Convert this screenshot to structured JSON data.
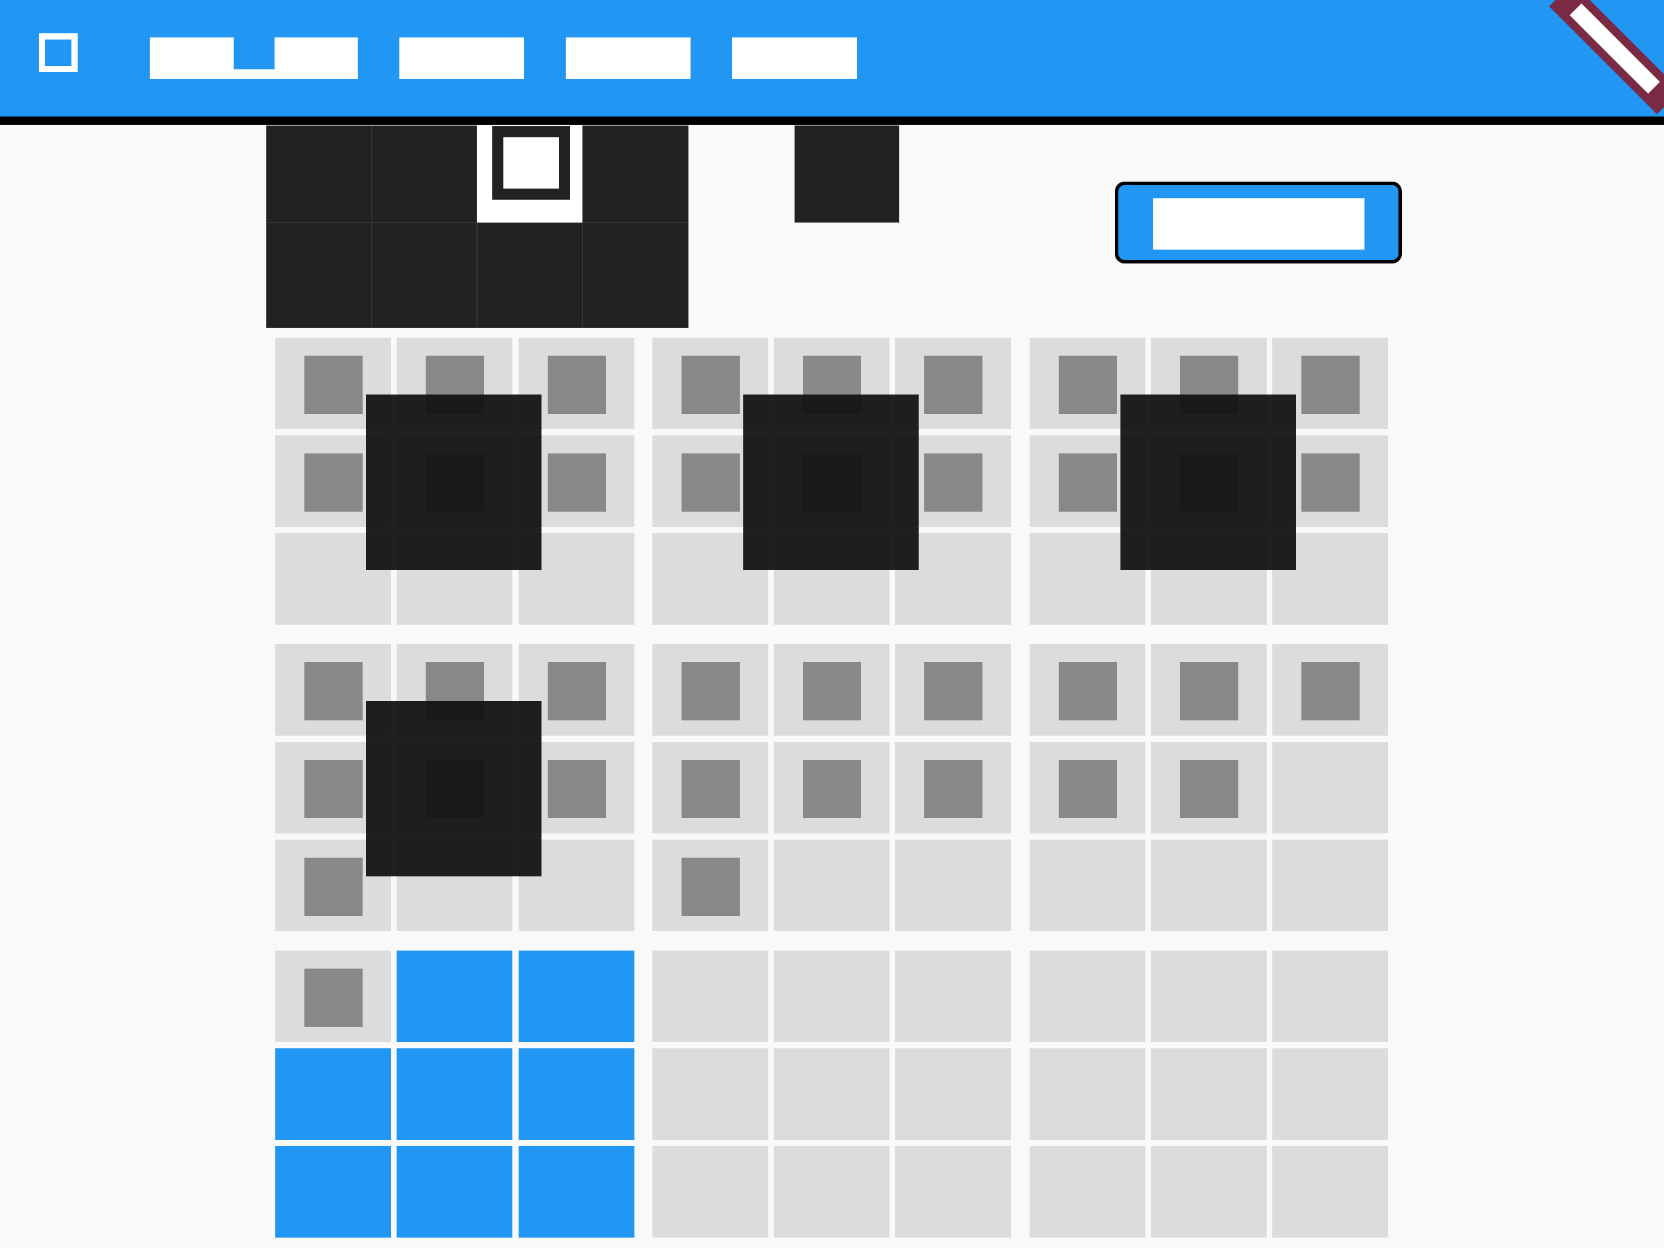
{
  "appbar": {
    "menu_icon": "menu-square-icon",
    "tabs": [
      {
        "label": ""
      },
      {
        "label": ""
      },
      {
        "label": ""
      },
      {
        "label": ""
      }
    ],
    "corner_icon": "ribbon-badge-icon",
    "colors": {
      "bar": "#2196f3",
      "ribbon": "#7b2a44"
    }
  },
  "action_button": {
    "label": ""
  },
  "board": {
    "rows": 9,
    "cols": 9,
    "filled_cells": [
      [
        0,
        0
      ],
      [
        0,
        1
      ],
      [
        0,
        2
      ],
      [
        0,
        3
      ],
      [
        0,
        4
      ],
      [
        0,
        5
      ],
      [
        0,
        6
      ],
      [
        0,
        7
      ],
      [
        0,
        8
      ],
      [
        1,
        0
      ],
      [
        1,
        1
      ],
      [
        1,
        2
      ],
      [
        1,
        3
      ],
      [
        1,
        4
      ],
      [
        1,
        5
      ],
      [
        1,
        6
      ],
      [
        1,
        7
      ],
      [
        1,
        8
      ],
      [
        3,
        0
      ],
      [
        3,
        1
      ],
      [
        3,
        2
      ],
      [
        3,
        3
      ],
      [
        3,
        4
      ],
      [
        3,
        5
      ],
      [
        3,
        6
      ],
      [
        3,
        7
      ],
      [
        3,
        8
      ],
      [
        4,
        0
      ],
      [
        4,
        1
      ],
      [
        4,
        2
      ],
      [
        4,
        3
      ],
      [
        4,
        4
      ],
      [
        4,
        5
      ],
      [
        4,
        6
      ],
      [
        4,
        7
      ],
      [
        5,
        0
      ],
      [
        5,
        3
      ],
      [
        6,
        0
      ]
    ],
    "highlight_cells": [
      [
        6,
        1
      ],
      [
        6,
        2
      ],
      [
        7,
        0
      ],
      [
        7,
        1
      ],
      [
        7,
        2
      ],
      [
        8,
        0
      ],
      [
        8,
        1
      ],
      [
        8,
        2
      ]
    ],
    "overlay_blocks": [
      [
        1,
        1
      ],
      [
        1,
        4
      ],
      [
        1,
        7
      ],
      [
        4,
        1
      ]
    ],
    "colors": {
      "empty": "#dcdcdc",
      "filled": "#888888",
      "highlight": "#2196f3",
      "overlay": "#121212"
    }
  }
}
